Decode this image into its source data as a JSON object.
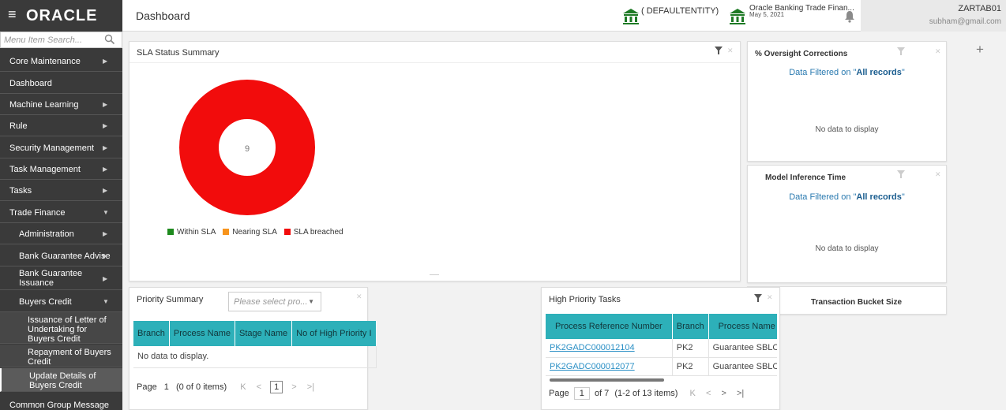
{
  "header": {
    "logo": "ORACLE",
    "hamburger": "≡",
    "page_title": "Dashboard",
    "entity": "( DEFAULTENTITY)",
    "app_name": "Oracle Banking Trade Finan...",
    "app_date": "May 5, 2021",
    "user_name": "ZARTAB01",
    "user_email": "subham@gmail.com"
  },
  "sidebar": {
    "search_placeholder": "Menu Item Search...",
    "items": [
      {
        "label": "Core Maintenance"
      },
      {
        "label": "Dashboard"
      },
      {
        "label": "Machine Learning"
      },
      {
        "label": "Rule"
      },
      {
        "label": "Security Management"
      },
      {
        "label": "Task Management"
      },
      {
        "label": "Tasks"
      },
      {
        "label": "Trade Finance"
      },
      {
        "label": "Administration"
      },
      {
        "label": "Bank Guarantee Advise"
      },
      {
        "label": "Bank Guarantee Issuance"
      },
      {
        "label": "Buyers Credit"
      },
      {
        "label": "Issuance of Letter of Undertaking for Buyers Credit"
      },
      {
        "label": "Repayment of Buyers Credit"
      },
      {
        "label": "Update Details of Buyers Credit"
      },
      {
        "label": "Common Group Message"
      }
    ]
  },
  "sla": {
    "title": "SLA Status Summary",
    "center_value": "9",
    "legend": [
      "Within SLA",
      "Nearing SLA",
      "SLA breached"
    ],
    "colors": {
      "within": "#1e8a1e",
      "nearing": "#f7941d",
      "breached": "#f20c0c"
    }
  },
  "oversight": {
    "title": "% Oversight Corrections",
    "filtered_prefix": "Data Filtered on \"",
    "filtered_value": "All records",
    "filtered_suffix": "\"",
    "nodata": "No data to display"
  },
  "model": {
    "title": "Model Inference Time",
    "filtered_prefix": "Data Filtered on \"",
    "filtered_value": "All records",
    "filtered_suffix": "\"",
    "nodata": "No data to display"
  },
  "bucket": {
    "title": "Transaction Bucket Size"
  },
  "priority": {
    "title": "Priority Summary",
    "select_placeholder": "Please select pro...",
    "columns": [
      "Branch",
      "Process Name",
      "Stage Name",
      "No of High Priority I"
    ],
    "nodata": "No data to display.",
    "page_label": "Page",
    "page_num": "1",
    "items_text": "(0 of 0 items)",
    "current_page": "1"
  },
  "high_priority": {
    "title": "High Priority Tasks",
    "columns": [
      "Process Reference Number",
      "Branch",
      "Process Name"
    ],
    "rows": [
      {
        "ref": "PK2GADC000012104",
        "branch": "PK2",
        "process": "Guarantee SBLC Ad"
      },
      {
        "ref": "PK2GADC000012077",
        "branch": "PK2",
        "process": "Guarantee SBLC Ad"
      }
    ],
    "page_label": "Page",
    "page_num": "1",
    "of_pages": "of 7",
    "items_text": "(1-2 of 13 items)"
  }
}
